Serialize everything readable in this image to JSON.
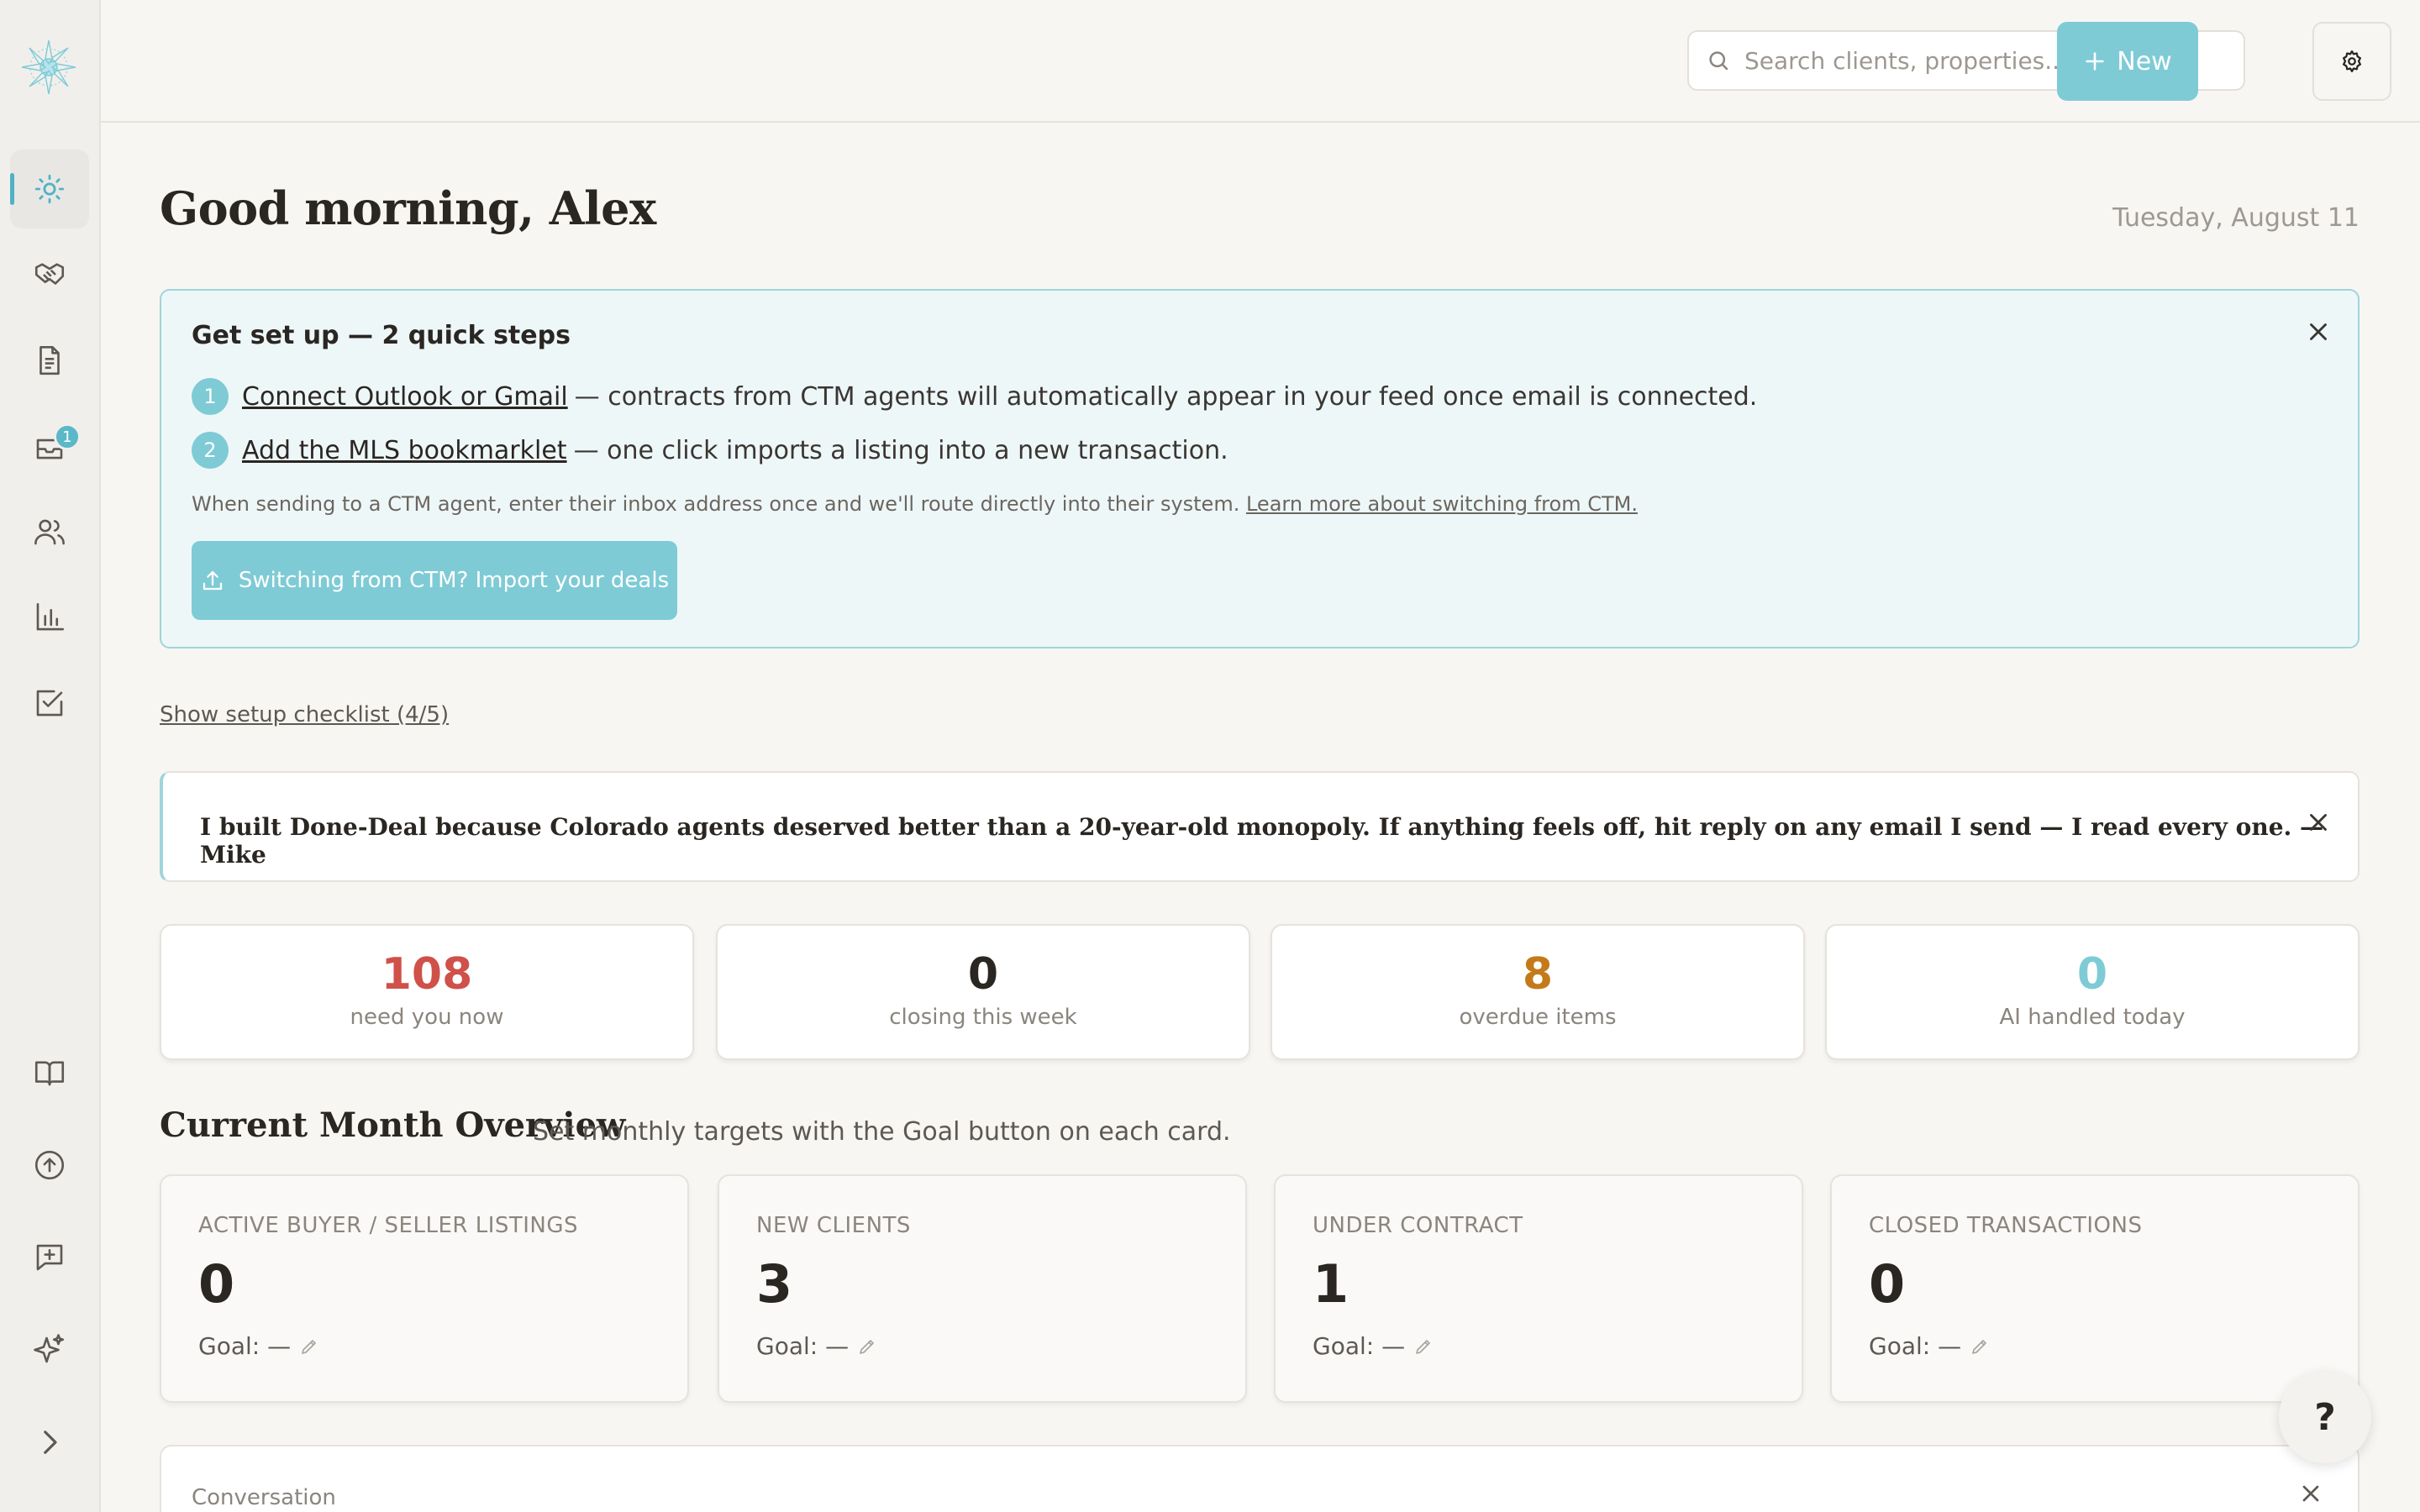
{
  "sidebar": {
    "logo": "sunburst-logo",
    "items": [
      {
        "name": "dashboard",
        "icon": "sun-icon",
        "active": true
      },
      {
        "name": "deals",
        "icon": "handshake-icon"
      },
      {
        "name": "documents",
        "icon": "document-icon"
      },
      {
        "name": "inbox",
        "icon": "inbox-icon",
        "badge": "1"
      },
      {
        "name": "clients",
        "icon": "users-icon"
      },
      {
        "name": "reports",
        "icon": "bar-chart-icon"
      },
      {
        "name": "tasks",
        "icon": "checkbox-icon"
      },
      {
        "name": "guides",
        "icon": "book-icon"
      },
      {
        "name": "upload",
        "icon": "upload-circle-icon"
      },
      {
        "name": "feedback",
        "icon": "message-plus-icon"
      },
      {
        "name": "ai",
        "icon": "sparkles-icon"
      },
      {
        "name": "expand",
        "icon": "chevron-right-icon"
      }
    ]
  },
  "topbar": {
    "search_placeholder": "Search clients, properties...",
    "new_label": "New"
  },
  "greeting": "Good morning, Alex",
  "date": "Tuesday, August 11",
  "setup": {
    "title": "Get set up — 2 quick steps",
    "steps": [
      {
        "num": "1",
        "link": "Connect Outlook or Gmail",
        "text": "— contracts from CTM agents will automatically appear in your feed once email is connected."
      },
      {
        "num": "2",
        "link": "Add the MLS bookmarklet",
        "text": "— one click imports a listing into a new transaction."
      }
    ],
    "note": "When sending to a CTM agent, enter their inbox address once and we'll route directly into their system.",
    "note_link": "Learn more about switching from CTM.",
    "import_label": "Switching from CTM? Import your deals"
  },
  "checklist_label": "Show setup checklist (4/5)",
  "quote": "I built Done-Deal because Colorado agents deserved better than a 20-year-old monopoly. If anything feels off, hit reply on any email I send — I read every one. — Mike",
  "stats": [
    {
      "value": "108",
      "label": "need you now",
      "color": "#d0504a"
    },
    {
      "value": "0",
      "label": "closing this week",
      "color": "#2a2622"
    },
    {
      "value": "8",
      "label": "overdue items",
      "color": "#c47a1a"
    },
    {
      "value": "0",
      "label": "AI handled today",
      "color": "#7ecbd6"
    }
  ],
  "overview": {
    "title": "Current Month Overview",
    "subtitle": "Set monthly targets with the Goal button on each card.",
    "cards": [
      {
        "title": "ACTIVE BUYER / SELLER LISTINGS",
        "value": "0",
        "goal": "Goal: —"
      },
      {
        "title": "NEW CLIENTS",
        "value": "3",
        "goal": "Goal: —"
      },
      {
        "title": "UNDER CONTRACT",
        "value": "1",
        "goal": "Goal: —"
      },
      {
        "title": "CLOSED TRANSACTIONS",
        "value": "0",
        "goal": "Goal: —"
      }
    ]
  },
  "conversation_title": "Conversation",
  "help_label": "?",
  "colors": {
    "accent": "#7ecbd6",
    "accent_border": "#9fd4dc",
    "background": "#f8f6f3"
  }
}
